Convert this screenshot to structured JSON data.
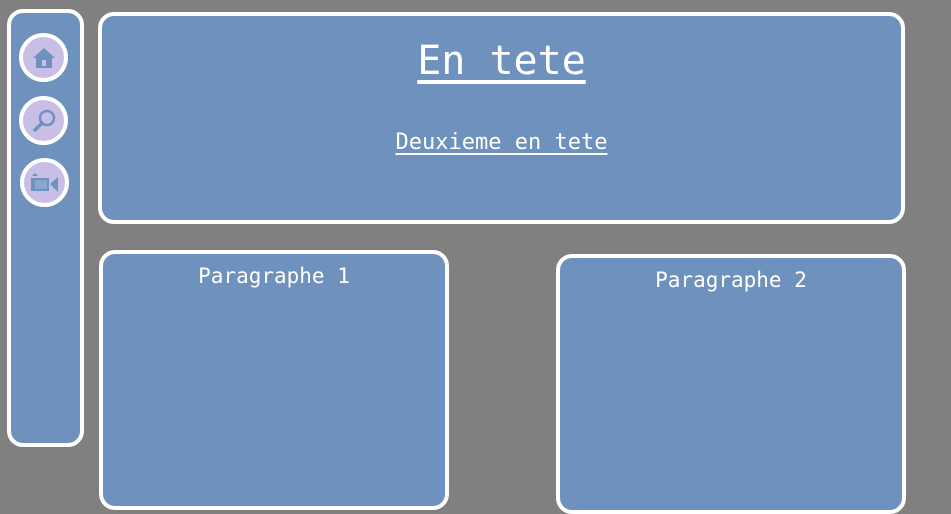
{
  "sidebar": {
    "items": [
      {
        "icon": "home-icon"
      },
      {
        "icon": "search-icon"
      },
      {
        "icon": "video-camera-icon"
      }
    ]
  },
  "header": {
    "title": "En tete",
    "subtitle": "Deuxieme en tete"
  },
  "paragraphs": [
    {
      "title": "Paragraphe 1"
    },
    {
      "title": "Paragraphe 2"
    }
  ],
  "colors": {
    "background": "#808080",
    "panel": "#6e91bd",
    "border": "#ffffff",
    "icon_circle": "#c9bfe6"
  }
}
